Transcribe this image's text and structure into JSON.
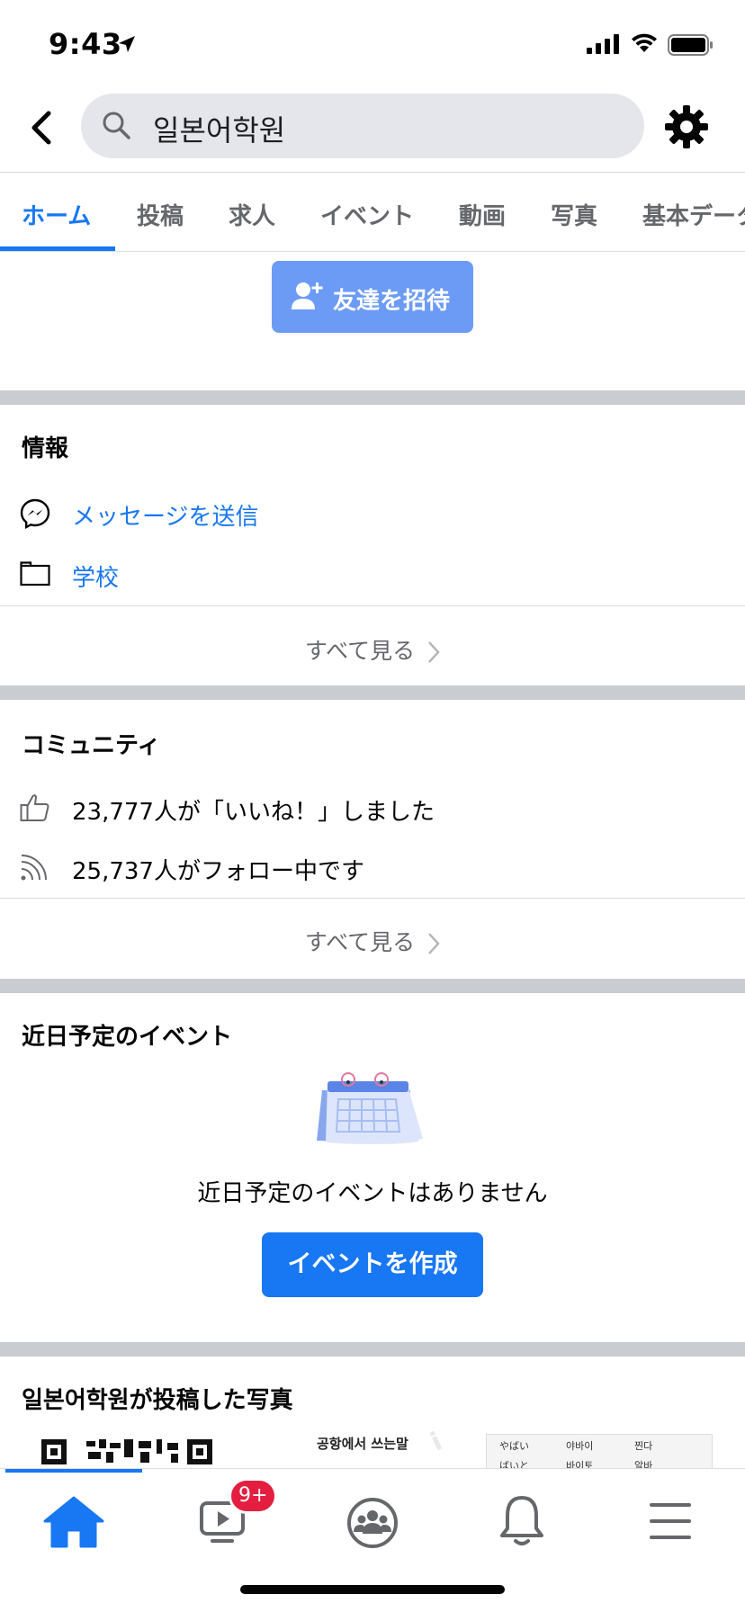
{
  "status_bar": {
    "time": "9:43"
  },
  "search": {
    "query": "일본어학원"
  },
  "tabs": [
    {
      "label": "ホーム"
    },
    {
      "label": "投稿"
    },
    {
      "label": "求人"
    },
    {
      "label": "イベント"
    },
    {
      "label": "動画"
    },
    {
      "label": "写真"
    },
    {
      "label": "基本データ"
    }
  ],
  "invite": {
    "label": "友達を招待"
  },
  "info": {
    "title": "情報",
    "message_label": "メッセージを送信",
    "category_label": "学校",
    "see_all": "すべて見る"
  },
  "community": {
    "title": "コミュニティ",
    "likes_text": "23,777人が「いいね！」しました",
    "follows_text": "25,737人がフォロー中です",
    "see_all": "すべて見る"
  },
  "events": {
    "title": "近日予定のイベント",
    "empty_text": "近日予定のイベントはありません",
    "create_label": "イベントを作成"
  },
  "photos": {
    "title": "일본어학원が投稿した写真",
    "thumb2_caption": "공항에서 쓰는말",
    "thumb3_cells": [
      "やばい",
      "야바이",
      "찐다",
      "ばいと",
      "바이토",
      "알바"
    ]
  },
  "bottom_nav": {
    "watch_badge": "9+"
  },
  "colors": {
    "accent": "#1877f2",
    "invite_button": "#6b9bf5",
    "badge": "#e41e3f",
    "divider": "#c9ccd1"
  }
}
